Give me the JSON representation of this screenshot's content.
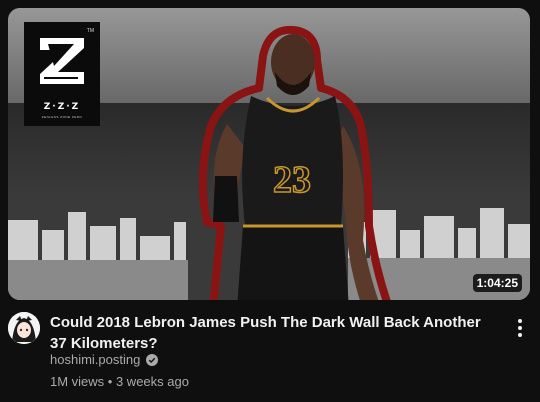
{
  "thumbnail": {
    "logo_text": "Z·Z·Z",
    "logo_subtext": "ZENLESS ZONE ZERO",
    "logo_tm": "TM",
    "jersey_number": "23",
    "duration": "1:04:25"
  },
  "video": {
    "title": "Could 2018 Lebron James Push The Dark Wall Back Another 37 Kilometers?",
    "channel": "hoshimi.posting",
    "views": "1M views",
    "age": "3 weeks ago",
    "meta_separator": " • "
  },
  "icons": {
    "verified": "verified-check-icon",
    "menu": "more-vert-icon"
  },
  "colors": {
    "background": "#0f0f0f",
    "title": "#f1f1f1",
    "secondary_text": "#aaaaaa",
    "jersey": "#1a1a1a",
    "outline": "#8a1414"
  }
}
